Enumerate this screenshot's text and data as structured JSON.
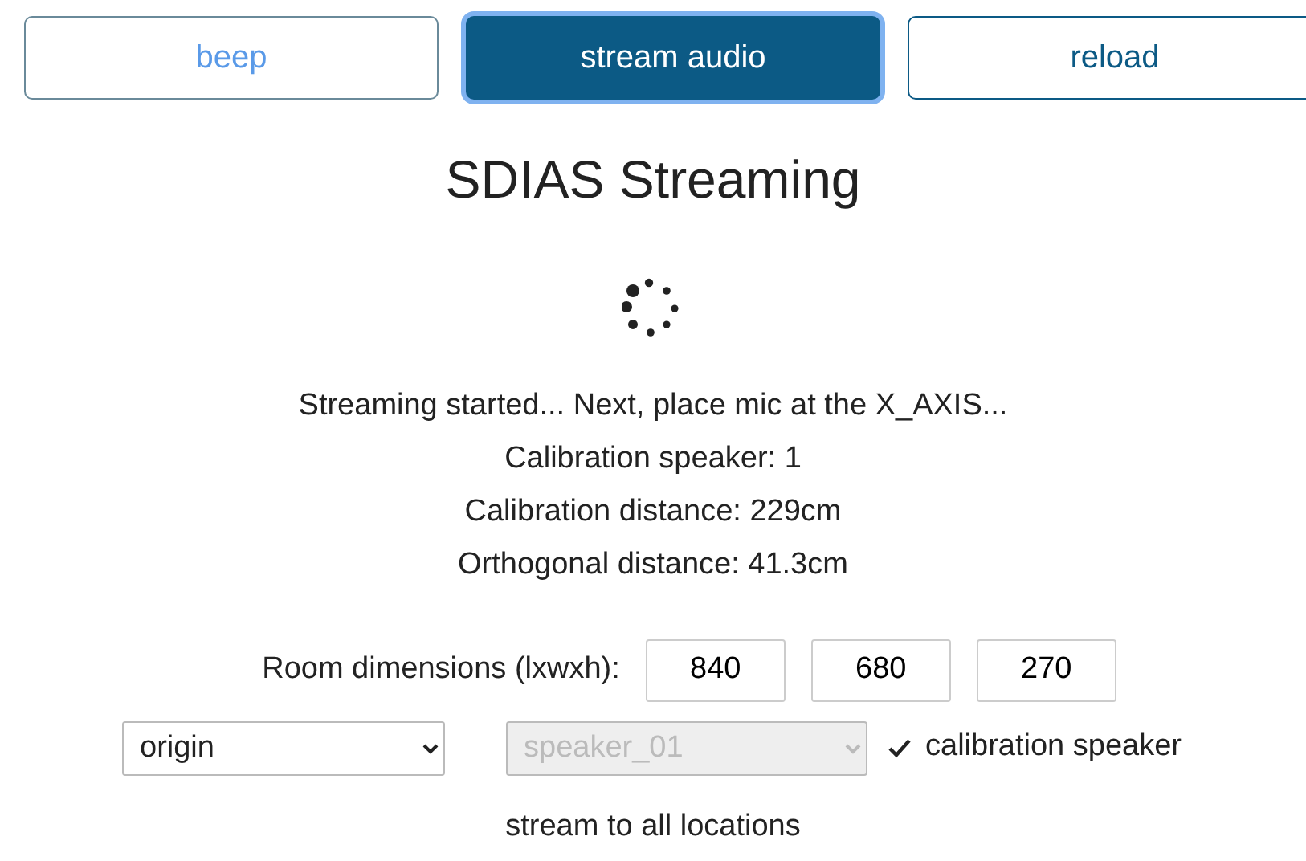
{
  "buttons": [
    {
      "label": "beep",
      "selected": false,
      "disabled": true
    },
    {
      "label": "stream audio",
      "selected": true,
      "disabled": false
    },
    {
      "label": "reload",
      "selected": false,
      "disabled": false
    }
  ],
  "title": "SDIAS Streaming",
  "status_lines": [
    "Streaming started... Next, place mic at the X_AXIS...",
    "Calibration speaker: 1",
    "Calibration distance: 229cm",
    "Orthogonal distance: 41.3cm"
  ],
  "room_dimensions": {
    "label": "Room dimensions (lxwxh):",
    "values": [
      "840",
      "680",
      "270"
    ]
  },
  "selects": [
    {
      "value": "origin",
      "disabled": false
    },
    {
      "value": "speaker_01",
      "disabled": true
    }
  ],
  "calibration_checkbox": {
    "label": "calibration speaker",
    "checked": true
  },
  "stream_all": "stream to all locations"
}
